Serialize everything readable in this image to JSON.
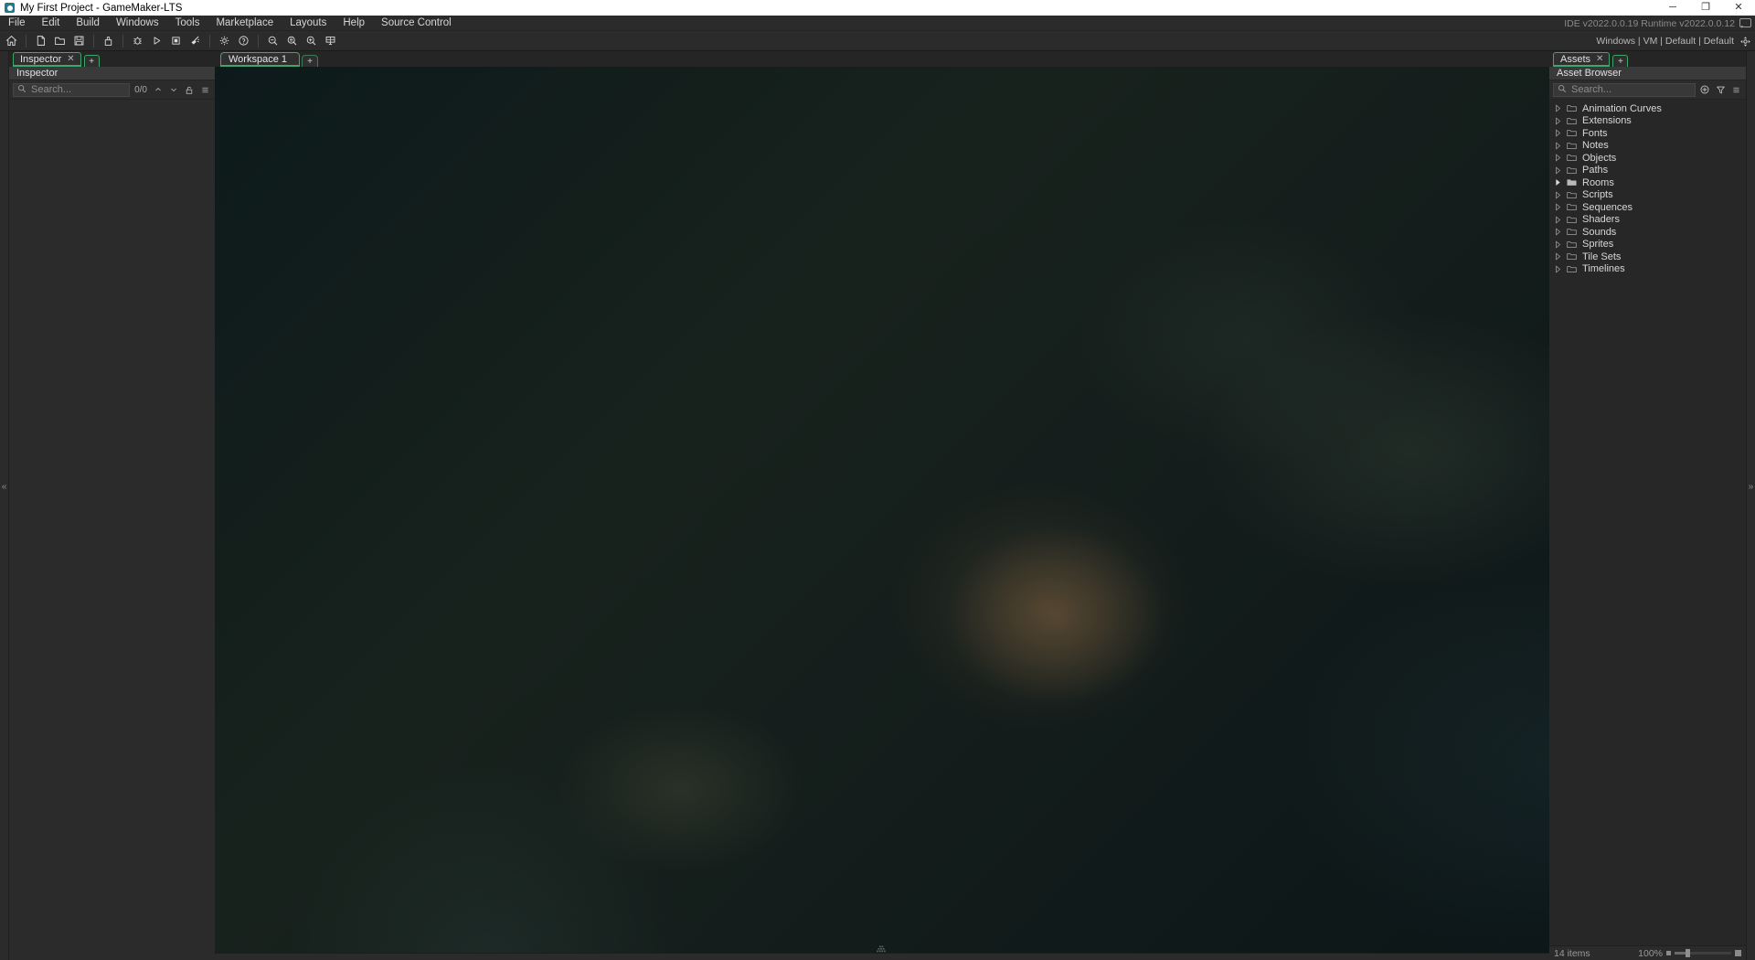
{
  "window": {
    "title": "My First Project - GameMaker-LTS",
    "logo_icon": "gamemaker-logo-icon",
    "minimize_label": "─",
    "maximize_label": "❐",
    "close_label": "✕"
  },
  "menubar": {
    "items": [
      {
        "label": "File",
        "name": "menu-file"
      },
      {
        "label": "Edit",
        "name": "menu-edit"
      },
      {
        "label": "Build",
        "name": "menu-build"
      },
      {
        "label": "Windows",
        "name": "menu-windows"
      },
      {
        "label": "Tools",
        "name": "menu-tools"
      },
      {
        "label": "Marketplace",
        "name": "menu-marketplace"
      },
      {
        "label": "Layouts",
        "name": "menu-layouts"
      },
      {
        "label": "Help",
        "name": "menu-help"
      },
      {
        "label": "Source Control",
        "name": "menu-source-control"
      }
    ],
    "version_info": "IDE v2022.0.0.19  Runtime v2022.0.0.12",
    "feedback_icon": "speech-bubble-icon"
  },
  "toolbar": {
    "buttons": [
      {
        "name": "home-button",
        "icon": "home-icon",
        "tooltip": "Home"
      },
      {
        "name": "new-project-button",
        "icon": "new-file-icon",
        "tooltip": "New Project"
      },
      {
        "name": "open-project-button",
        "icon": "open-folder-icon",
        "tooltip": "Open Project"
      },
      {
        "name": "save-project-button",
        "icon": "save-disk-icon",
        "tooltip": "Save Project"
      },
      {
        "name": "create-executable-button",
        "icon": "package-icon",
        "tooltip": "Create Executable"
      },
      {
        "name": "debug-button",
        "icon": "bug-icon",
        "tooltip": "Debug"
      },
      {
        "name": "run-button",
        "icon": "play-icon",
        "tooltip": "Run"
      },
      {
        "name": "stop-button",
        "icon": "stop-square-icon",
        "tooltip": "Stop"
      },
      {
        "name": "clean-button",
        "icon": "broom-icon",
        "tooltip": "Clean"
      },
      {
        "name": "preferences-button",
        "icon": "gear-icon",
        "tooltip": "Preferences"
      },
      {
        "name": "help-button",
        "icon": "question-mark-icon",
        "tooltip": "Help"
      },
      {
        "name": "zoom-out-button",
        "icon": "zoom-out-icon",
        "tooltip": "Zoom Out"
      },
      {
        "name": "zoom-reset-button",
        "icon": "zoom-reset-icon",
        "tooltip": "Zoom Reset"
      },
      {
        "name": "zoom-in-button",
        "icon": "zoom-in-icon",
        "tooltip": "Zoom In"
      },
      {
        "name": "fit-to-screen-button",
        "icon": "fit-screen-icon",
        "tooltip": "Fit To Screen"
      }
    ],
    "target_platform": "Windows  |  VM  |  Default  |  Default",
    "target_icon": "target-selector-icon"
  },
  "inspector": {
    "tab_label": "Inspector",
    "tab_close": "✕",
    "tab_add": "+",
    "header_label": "Inspector",
    "search": {
      "placeholder": "Search...",
      "icon": "search-icon",
      "match_count": "0/0",
      "prev_icon": "chevron-up-icon",
      "next_icon": "chevron-down-icon",
      "lock_icon": "unlock-padlock-icon",
      "menu_icon": "hamburger-menu-icon"
    }
  },
  "assets": {
    "tab_label": "Assets",
    "tab_close": "✕",
    "tab_add": "+",
    "header_label": "Asset Browser",
    "search": {
      "placeholder": "Search...",
      "icon": "search-icon",
      "add_icon": "add-circle-icon",
      "filter_icon": "funnel-filter-icon",
      "menu_icon": "hamburger-menu-icon"
    },
    "tree": [
      {
        "label": "Animation Curves",
        "expanded": false,
        "has_children": false
      },
      {
        "label": "Extensions",
        "expanded": false,
        "has_children": false
      },
      {
        "label": "Fonts",
        "expanded": false,
        "has_children": false
      },
      {
        "label": "Notes",
        "expanded": false,
        "has_children": false
      },
      {
        "label": "Objects",
        "expanded": false,
        "has_children": false
      },
      {
        "label": "Paths",
        "expanded": false,
        "has_children": false
      },
      {
        "label": "Rooms",
        "expanded": false,
        "has_children": true
      },
      {
        "label": "Scripts",
        "expanded": false,
        "has_children": false
      },
      {
        "label": "Sequences",
        "expanded": false,
        "has_children": false
      },
      {
        "label": "Shaders",
        "expanded": false,
        "has_children": false
      },
      {
        "label": "Sounds",
        "expanded": false,
        "has_children": false
      },
      {
        "label": "Sprites",
        "expanded": false,
        "has_children": false
      },
      {
        "label": "Tile Sets",
        "expanded": false,
        "has_children": false
      },
      {
        "label": "Timelines",
        "expanded": false,
        "has_children": false
      }
    ],
    "status": {
      "item_count": "14 items",
      "zoom_level": "100%"
    }
  },
  "workspace": {
    "tab_label": "Workspace 1",
    "tab_add": "+",
    "grip_icon": "drag-grip-icon"
  },
  "rails": {
    "left_collapse": "«",
    "right_collapse": "»"
  },
  "colors": {
    "accent_green": "#3ea66b",
    "titlebar_bg": "#ffffff",
    "chrome_bg": "#2b2b2b",
    "panel_bg": "#272727",
    "canvas_base": "#121c1a"
  }
}
